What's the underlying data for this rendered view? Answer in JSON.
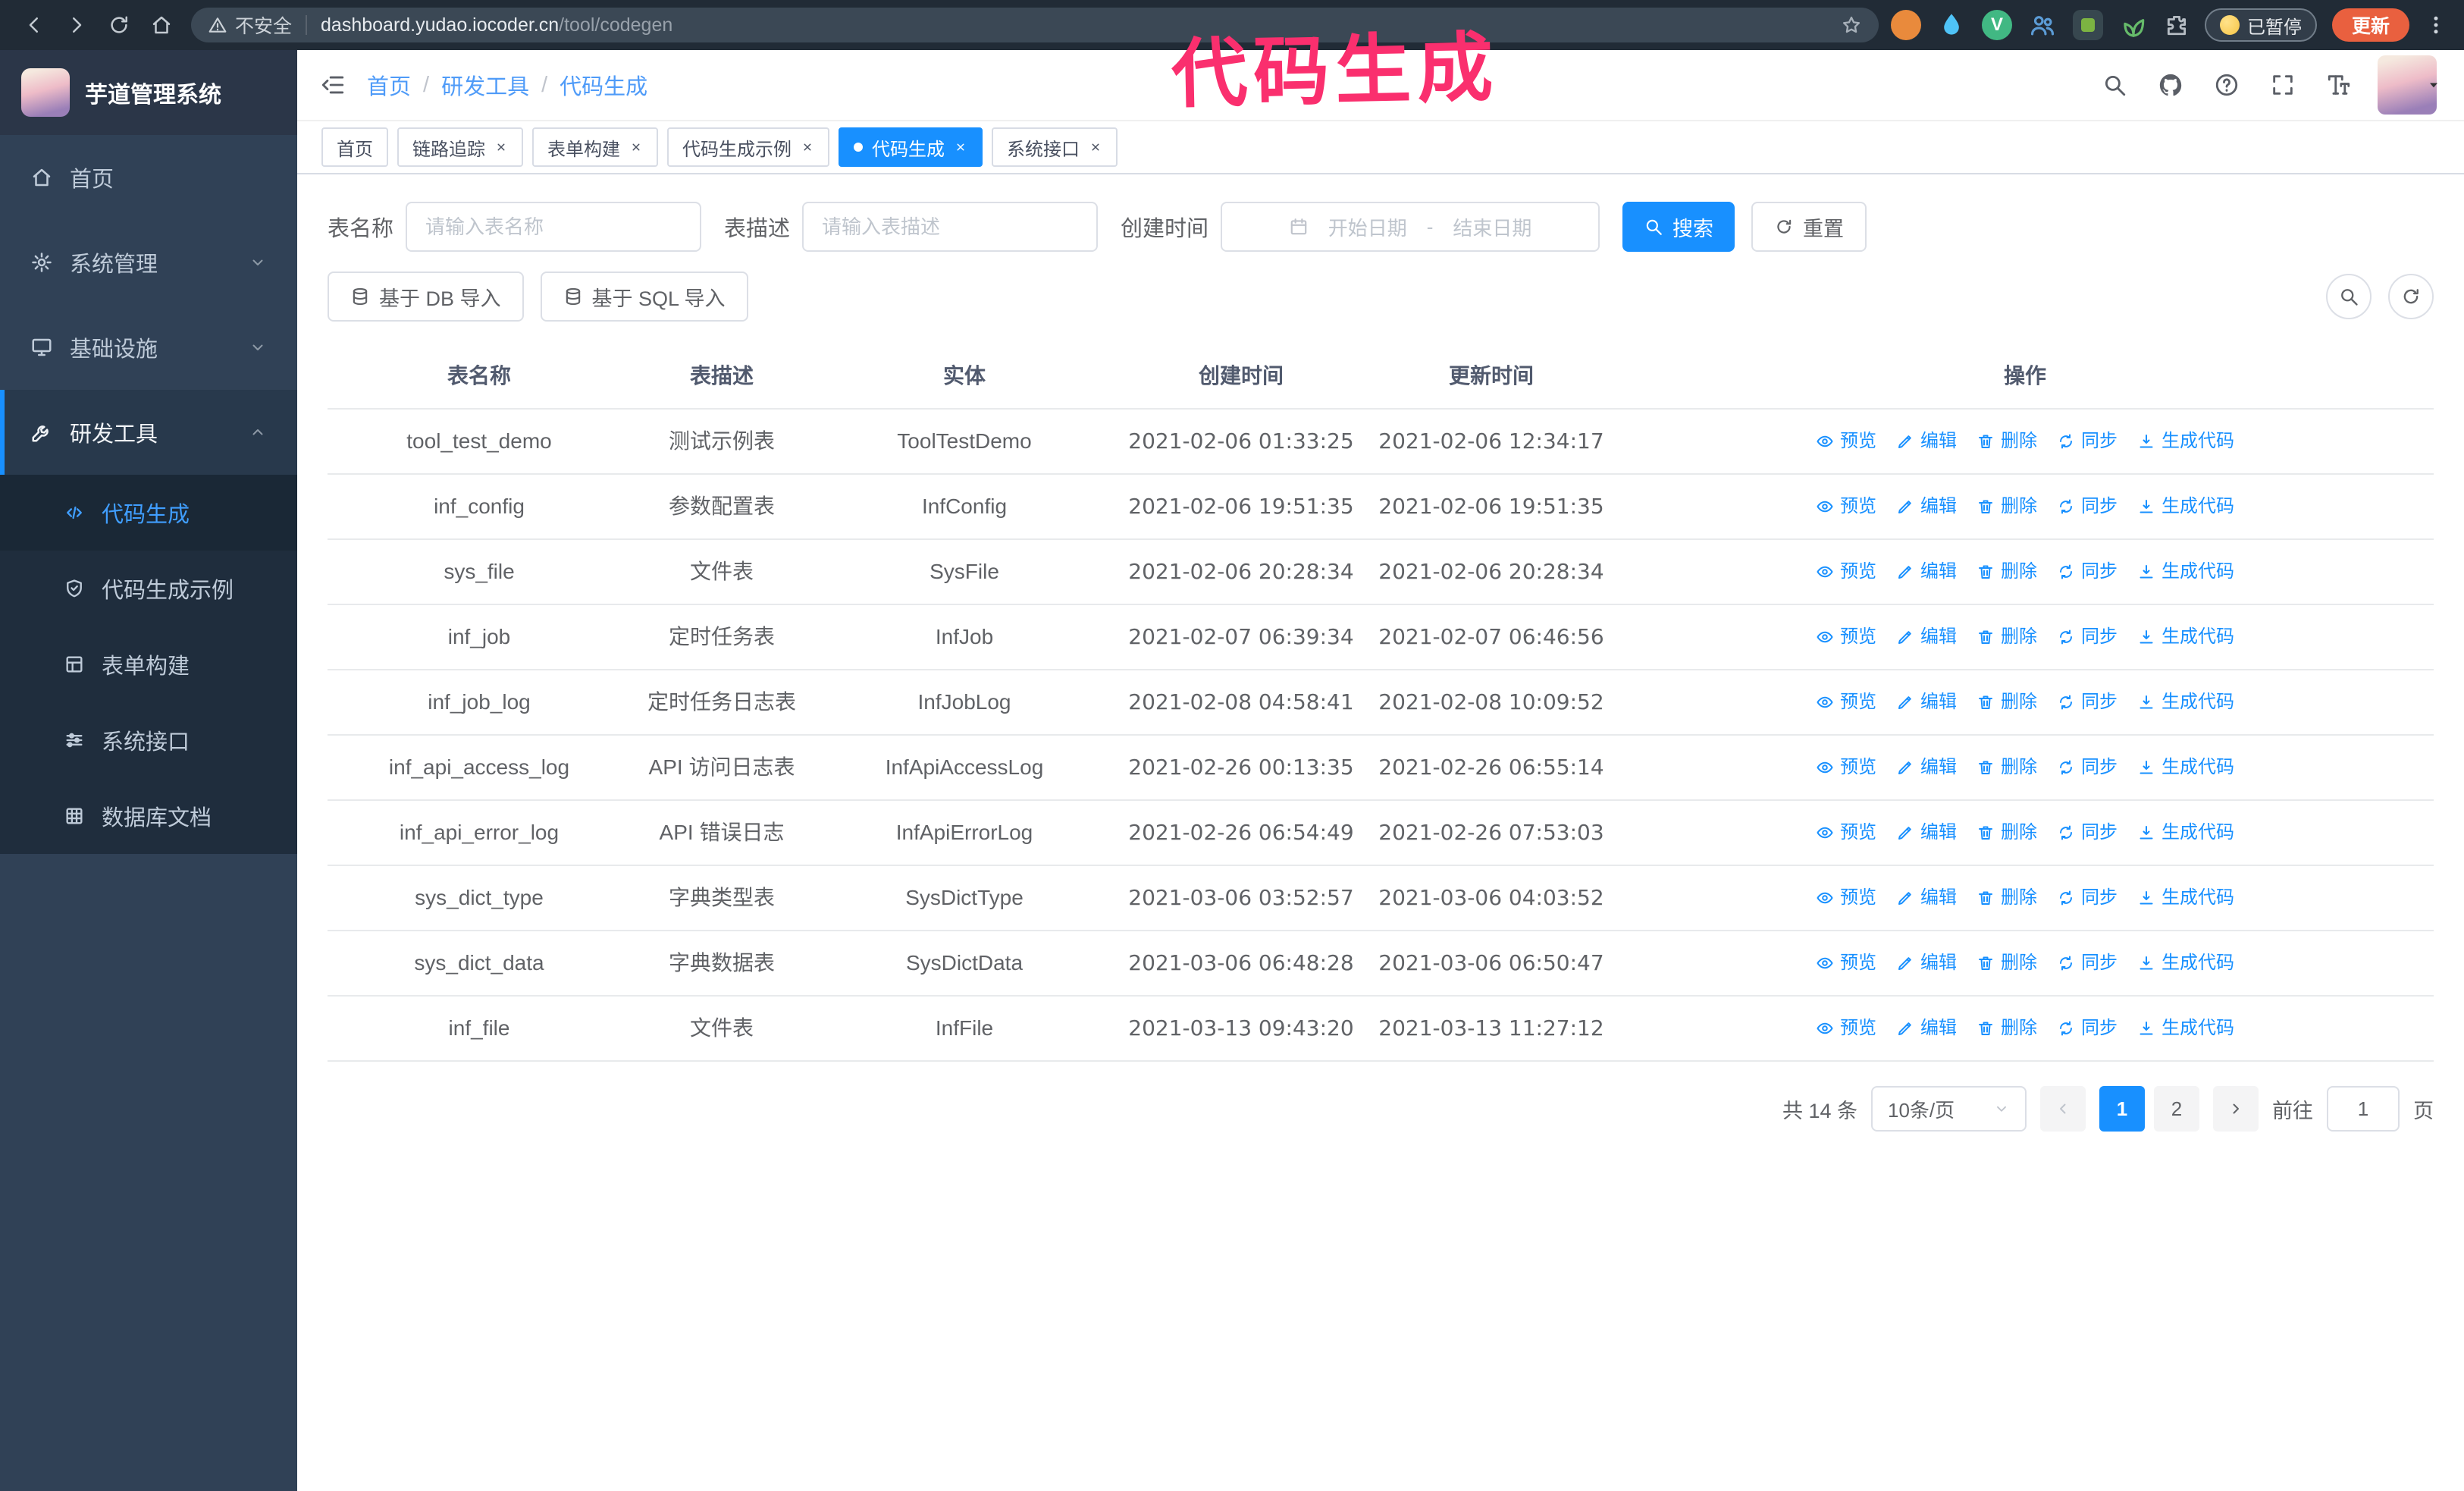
{
  "theme": {
    "accent": "#1890ff",
    "browser_bar_bg": "#212b36",
    "sidebar_bg": "#304156",
    "submenu_bg": "#1f2d3d",
    "annotation_color": "#fa2f6e",
    "update_button_bg": "#e9603f"
  },
  "annotation": {
    "text": "代码生成"
  },
  "browser": {
    "nav_icons": [
      "arrow-left",
      "arrow-right",
      "reload",
      "home"
    ],
    "security_label": "不安全",
    "url_host": "dashboard.yudao.iocoder.cn",
    "url_path": "/tool/codegen",
    "paused_label": "已暂停",
    "update_label": "更新"
  },
  "sidebar": {
    "logo_title": "芋道管理系统",
    "menu": [
      {
        "label": "首页",
        "icon": "home"
      },
      {
        "label": "系统管理",
        "icon": "gear",
        "chevron": "down"
      },
      {
        "label": "基础设施",
        "icon": "monitor",
        "chevron": "down"
      },
      {
        "label": "研发工具",
        "icon": "tool",
        "chevron": "up",
        "active": true
      }
    ],
    "submenu": [
      {
        "label": "代码生成",
        "icon": "code",
        "active": true
      },
      {
        "label": "代码生成示例",
        "icon": "shield"
      },
      {
        "label": "表单构建",
        "icon": "form"
      },
      {
        "label": "系统接口",
        "icon": "sliders"
      },
      {
        "label": "数据库文档",
        "icon": "grid"
      }
    ]
  },
  "header": {
    "breadcrumb": [
      "首页",
      "研发工具",
      "代码生成"
    ],
    "icons": [
      "search",
      "github",
      "help",
      "fullscreen",
      "fontsize"
    ]
  },
  "tabs": [
    {
      "label": "首页",
      "closable": false,
      "active": false
    },
    {
      "label": "链路追踪",
      "closable": true,
      "active": false
    },
    {
      "label": "表单构建",
      "closable": true,
      "active": false
    },
    {
      "label": "代码生成示例",
      "closable": true,
      "active": false
    },
    {
      "label": "代码生成",
      "closable": true,
      "active": true
    },
    {
      "label": "系统接口",
      "closable": true,
      "active": false
    }
  ],
  "filters": {
    "table_name_label": "表名称",
    "table_name_placeholder": "请输入表名称",
    "table_desc_label": "表描述",
    "table_desc_placeholder": "请输入表描述",
    "create_time_label": "创建时间",
    "date_start_placeholder": "开始日期",
    "date_separator": "-",
    "date_end_placeholder": "结束日期",
    "search_label": "搜索",
    "reset_label": "重置"
  },
  "toolbar": {
    "import_db_label": "基于 DB 导入",
    "import_sql_label": "基于 SQL 导入"
  },
  "table": {
    "columns": [
      "表名称",
      "表描述",
      "实体",
      "创建时间",
      "更新时间",
      "操作"
    ],
    "actions": [
      {
        "label": "预览",
        "icon": "eye"
      },
      {
        "label": "编辑",
        "icon": "edit"
      },
      {
        "label": "删除",
        "icon": "trash"
      },
      {
        "label": "同步",
        "icon": "sync"
      },
      {
        "label": "生成代码",
        "icon": "download"
      }
    ],
    "rows": [
      {
        "name": "tool_test_demo",
        "desc": "测试示例表",
        "entity": "ToolTestDemo",
        "created": "2021-02-06 01:33:25",
        "updated": "2021-02-06 12:34:17"
      },
      {
        "name": "inf_config",
        "desc": "参数配置表",
        "entity": "InfConfig",
        "created": "2021-02-06 19:51:35",
        "updated": "2021-02-06 19:51:35"
      },
      {
        "name": "sys_file",
        "desc": "文件表",
        "entity": "SysFile",
        "created": "2021-02-06 20:28:34",
        "updated": "2021-02-06 20:28:34"
      },
      {
        "name": "inf_job",
        "desc": "定时任务表",
        "entity": "InfJob",
        "created": "2021-02-07 06:39:34",
        "updated": "2021-02-07 06:46:56"
      },
      {
        "name": "inf_job_log",
        "desc": "定时任务日志表",
        "entity": "InfJobLog",
        "created": "2021-02-08 04:58:41",
        "updated": "2021-02-08 10:09:52"
      },
      {
        "name": "inf_api_access_log",
        "desc": "API 访问日志表",
        "entity": "InfApiAccessLog",
        "created": "2021-02-26 00:13:35",
        "updated": "2021-02-26 06:55:14"
      },
      {
        "name": "inf_api_error_log",
        "desc": "API 错误日志",
        "entity": "InfApiErrorLog",
        "created": "2021-02-26 06:54:49",
        "updated": "2021-02-26 07:53:03"
      },
      {
        "name": "sys_dict_type",
        "desc": "字典类型表",
        "entity": "SysDictType",
        "created": "2021-03-06 03:52:57",
        "updated": "2021-03-06 04:03:52"
      },
      {
        "name": "sys_dict_data",
        "desc": "字典数据表",
        "entity": "SysDictData",
        "created": "2021-03-06 06:48:28",
        "updated": "2021-03-06 06:50:47"
      },
      {
        "name": "inf_file",
        "desc": "文件表",
        "entity": "InfFile",
        "created": "2021-03-13 09:43:20",
        "updated": "2021-03-13 11:27:12"
      }
    ]
  },
  "pagination": {
    "total_label": "共 14 条",
    "page_size_label": "10条/页",
    "pages": [
      "1",
      "2"
    ],
    "active_page": "1",
    "goto_prefix": "前往",
    "goto_value": "1",
    "goto_suffix": "页"
  }
}
